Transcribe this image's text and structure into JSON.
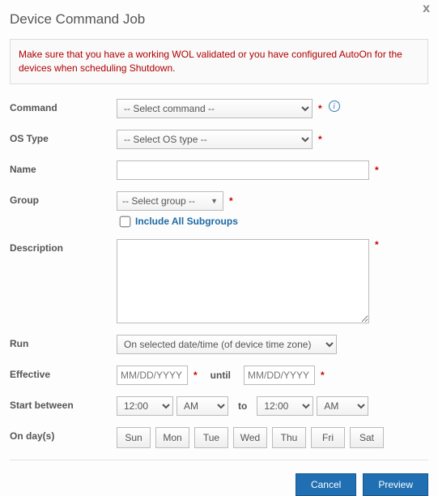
{
  "dialog": {
    "title": "Device Command Job",
    "close": "x"
  },
  "warning": "Make sure that you have a working WOL validated or you have configured AutoOn for the devices when scheduling Shutdown.",
  "labels": {
    "command": "Command",
    "osType": "OS Type",
    "name": "Name",
    "group": "Group",
    "includeSub": "Include All Subgroups",
    "description": "Description",
    "run": "Run",
    "effective": "Effective",
    "until": "until",
    "startBetween": "Start between",
    "to": "to",
    "onDays": "On day(s)"
  },
  "fields": {
    "command": {
      "placeholder": "-- Select command --",
      "value": ""
    },
    "osType": {
      "placeholder": "-- Select OS type --",
      "value": ""
    },
    "name": {
      "value": ""
    },
    "group": {
      "placeholder": "-- Select group --",
      "value": ""
    },
    "includeSub": false,
    "description": {
      "value": ""
    },
    "run": {
      "selected": "On selected date/time (of device time zone)"
    },
    "effectiveFrom": {
      "placeholder": "MM/DD/YYYY",
      "value": ""
    },
    "effectiveTo": {
      "placeholder": "MM/DD/YYYY",
      "value": ""
    },
    "startHourFrom": "12:00",
    "startAmPmFrom": "AM",
    "startHourTo": "12:00",
    "startAmPmTo": "AM"
  },
  "days": [
    "Sun",
    "Mon",
    "Tue",
    "Wed",
    "Thu",
    "Fri",
    "Sat"
  ],
  "buttons": {
    "cancel": "Cancel",
    "preview": "Preview"
  }
}
